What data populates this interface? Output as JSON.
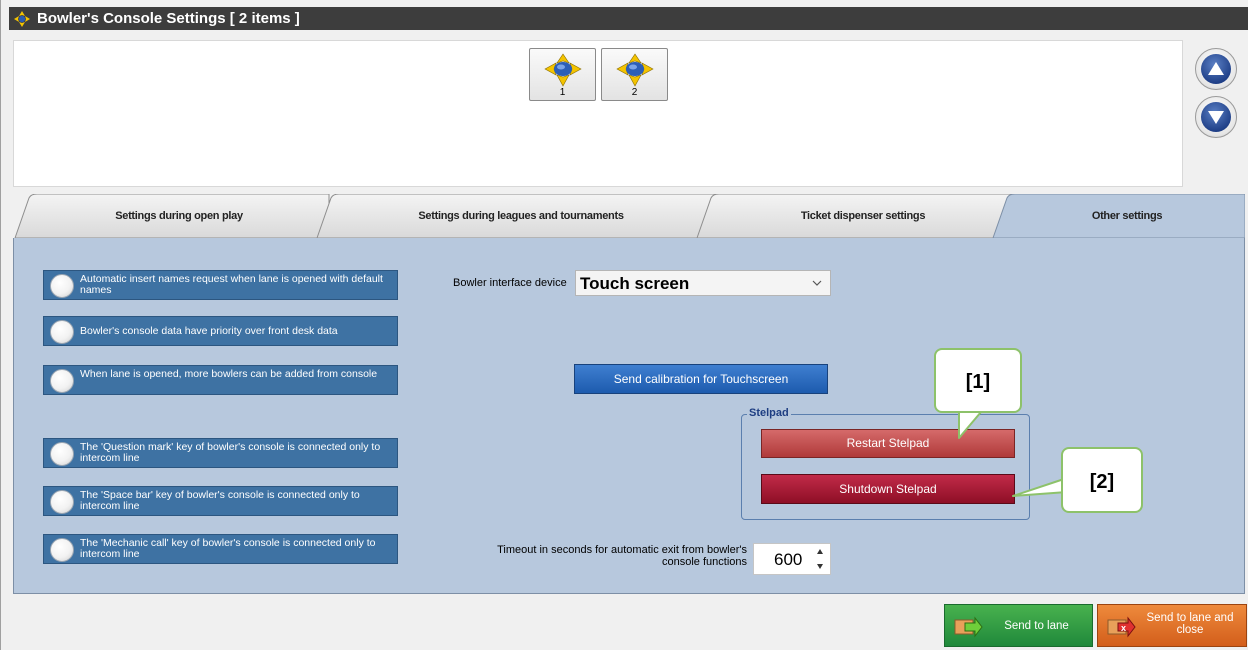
{
  "window": {
    "title": "Bowler's Console Settings [ 2 items ]"
  },
  "consoles": [
    {
      "number": "1"
    },
    {
      "number": "2"
    }
  ],
  "scroll": {
    "up_icon": "arrow-up-icon",
    "down_icon": "arrow-down-icon"
  },
  "tabs": [
    {
      "label": "Settings during open play",
      "active": false
    },
    {
      "label": "Settings during leagues and tournaments",
      "active": false
    },
    {
      "label": "Ticket dispenser settings",
      "active": false
    },
    {
      "label": "Other settings",
      "active": true
    }
  ],
  "options": [
    {
      "label": "Automatic insert names request when lane is opened with default names"
    },
    {
      "label": "Bowler's console data have priority over front desk data"
    },
    {
      "label": "When lane is opened, more bowlers can be added from console"
    },
    {
      "label": "The 'Question mark' key of bowler's console is connected only to intercom line"
    },
    {
      "label": "The 'Space bar' key of bowler's console is connected only to intercom line"
    },
    {
      "label": "The 'Mechanic call' key of bowler's console is connected only to intercom line"
    }
  ],
  "device": {
    "label": "Bowler interface device",
    "value": "Touch screen"
  },
  "calibration_button": "Send calibration for Touchscreen",
  "stelpad": {
    "group_title": "Stelpad",
    "restart_label": "Restart Stelpad",
    "shutdown_label": "Shutdown Stelpad"
  },
  "timeout": {
    "label": "Timeout in seconds for automatic exit from bowler's console functions",
    "value": "600"
  },
  "callouts": {
    "one": "[1]",
    "two": "[2]"
  },
  "actions": {
    "send_label": "Send to lane",
    "send_close_label": "Send to lane and close"
  },
  "colors": {
    "panel": "#b7c8dd",
    "option_toggle": "#3e72a3",
    "calibration_button": "#2a6cc0",
    "restart_button": "#c24b4b",
    "shutdown_button": "#a81a36",
    "send_button": "#2e9c43",
    "send_close_button": "#e06f27",
    "callout_border": "#8dc26a"
  }
}
